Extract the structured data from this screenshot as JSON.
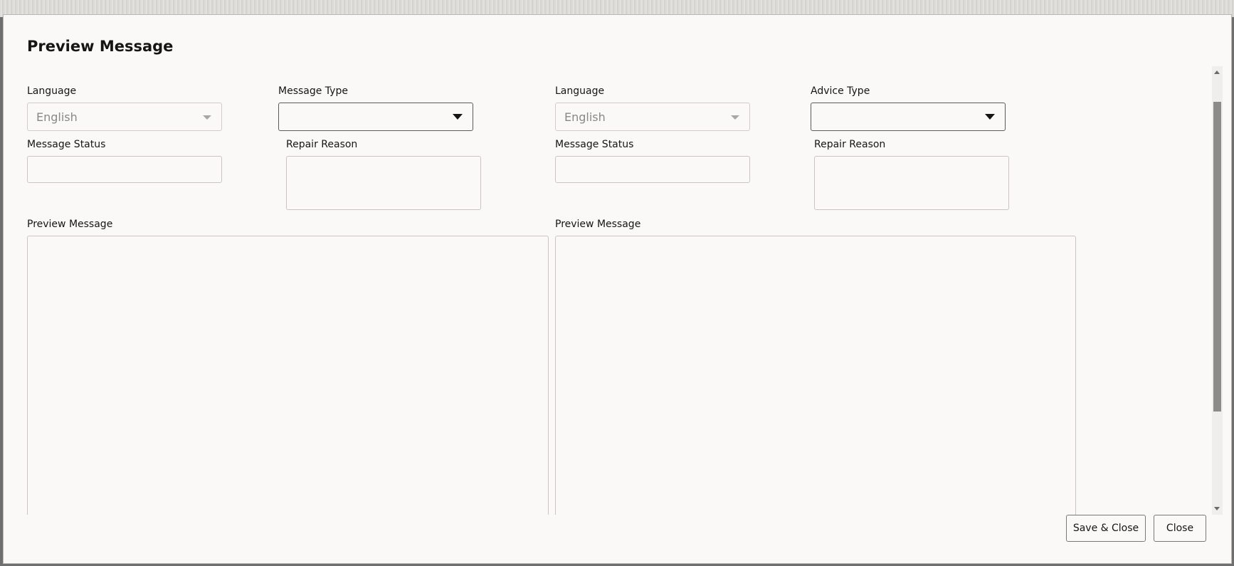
{
  "dialog": {
    "title": "Preview Message"
  },
  "left_panel": {
    "language_label": "Language",
    "language_value": "English",
    "message_type_label": "Message Type",
    "message_type_value": "",
    "message_status_label": "Message Status",
    "message_status_value": "",
    "repair_reason_label": "Repair Reason",
    "repair_reason_value": "",
    "preview_label": "Preview Message",
    "preview_value": ""
  },
  "right_panel": {
    "language_label": "Language",
    "language_value": "English",
    "advice_type_label": "Advice Type",
    "advice_type_value": "",
    "message_status_label": "Message Status",
    "message_status_value": "",
    "repair_reason_label": "Repair Reason",
    "repair_reason_value": "",
    "preview_label": "Preview Message",
    "preview_value": ""
  },
  "footer": {
    "save_close_label": "Save & Close",
    "close_label": "Close"
  }
}
